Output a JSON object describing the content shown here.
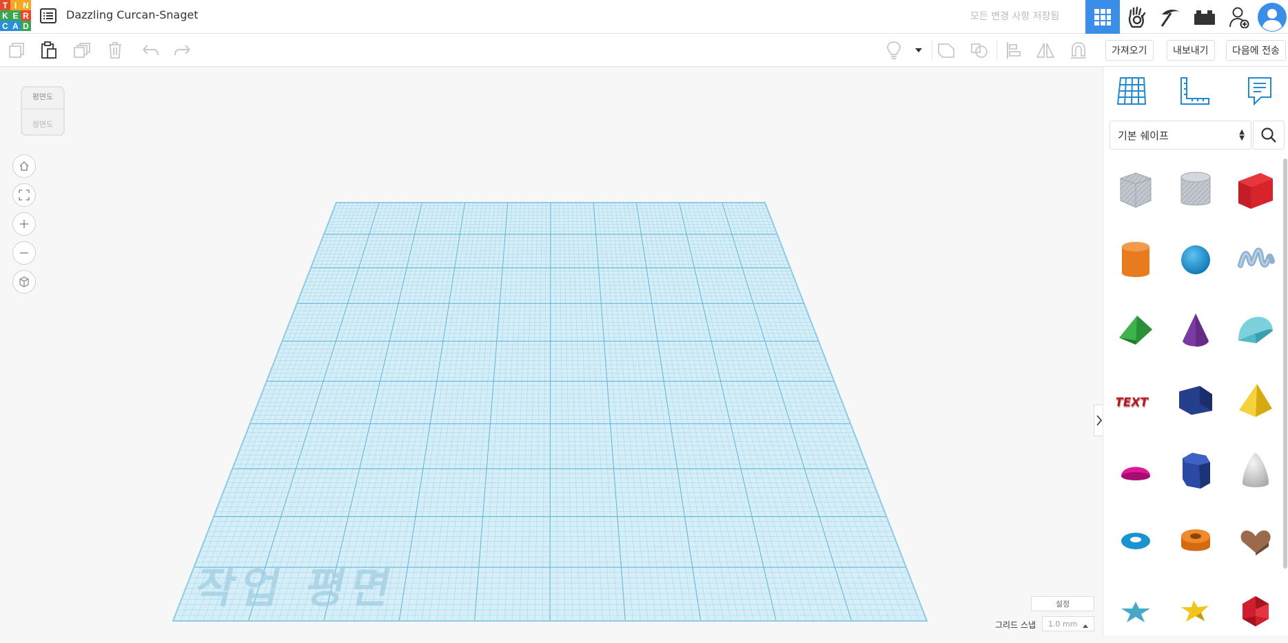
{
  "app": {
    "logo_letters": [
      "T",
      "I",
      "N",
      "K",
      "E",
      "R",
      "C",
      "A",
      "D"
    ],
    "logo_colors": [
      "#e8492b",
      "#f5a623",
      "#f5a623",
      "#3aa655",
      "#3aa655",
      "#e8492b",
      "#2a8fd6",
      "#2a8fd6",
      "#3aa655"
    ]
  },
  "header": {
    "title": "Dazzling Curcan-Snaget",
    "save_status": "모든 변경 사항 저장됨"
  },
  "toolbar": {
    "import_label": "가져오기",
    "export_label": "내보내기",
    "send_to_label": "다음에 전송"
  },
  "viewcube": {
    "top_label": "평면도",
    "front_label": "정면도"
  },
  "workplane": {
    "label": "작업 평면"
  },
  "bottom": {
    "settings_label": "설정",
    "grid_snap_label": "그리드 스냅",
    "grid_snap_value": "1.0 mm"
  },
  "panel": {
    "category": "기본 쉐이프",
    "accent": "#1f8ad0"
  },
  "shapes": [
    {
      "icon": "box-hole-icon",
      "color": "#b9bec6"
    },
    {
      "icon": "cylinder-hole-icon",
      "color": "#b9bec6"
    },
    {
      "icon": "box-icon",
      "color": "#d4202a"
    },
    {
      "icon": "cylinder-icon",
      "color": "#e87b1e"
    },
    {
      "icon": "sphere-icon",
      "color": "#1a93d0"
    },
    {
      "icon": "scribble-icon",
      "color": "#8fb1cf"
    },
    {
      "icon": "roof-icon",
      "color": "#2e9c3e"
    },
    {
      "icon": "cone-icon",
      "color": "#7b3aa1"
    },
    {
      "icon": "round-roof-icon",
      "color": "#58bccc"
    },
    {
      "icon": "text-icon",
      "color": "#c5212b"
    },
    {
      "icon": "wedge-icon",
      "color": "#263f8c"
    },
    {
      "icon": "pyramid-icon",
      "color": "#f2c418"
    },
    {
      "icon": "half-sphere-icon",
      "color": "#d5138a"
    },
    {
      "icon": "polygon-icon",
      "color": "#23408f"
    },
    {
      "icon": "paraboloid-icon",
      "color": "#d0d0d0"
    },
    {
      "icon": "torus-icon",
      "color": "#1a93d0"
    },
    {
      "icon": "tube-icon",
      "color": "#e87b1e"
    },
    {
      "icon": "heart-icon",
      "color": "#9b6a4d"
    },
    {
      "icon": "star-icon",
      "color": "#47a8c8"
    },
    {
      "icon": "star-gold-icon",
      "color": "#f0c51c"
    },
    {
      "icon": "icosahedron-icon",
      "color": "#d01f2c"
    }
  ]
}
